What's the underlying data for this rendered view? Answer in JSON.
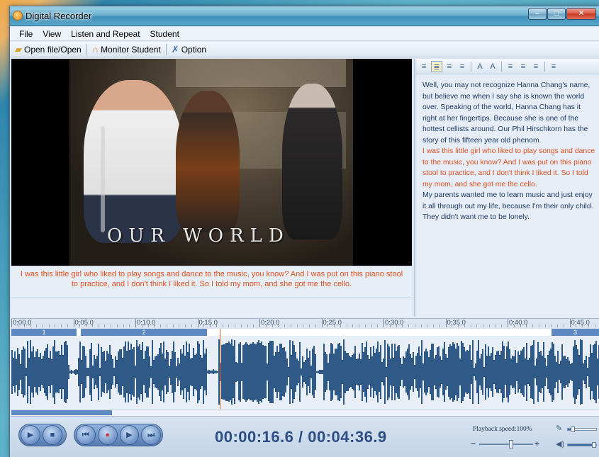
{
  "window": {
    "title": "Digital Recorder",
    "buttons": {
      "minimize": "–",
      "maximize": "□",
      "close": "✕"
    }
  },
  "menu": {
    "items": [
      "File",
      "View",
      "Listen and Repeat",
      "Student"
    ]
  },
  "toolbar": {
    "open_label": "Open file/Open",
    "monitor_label": "Monitor Student",
    "option_label": "Option"
  },
  "video": {
    "overlay_text": "OUR WORLD"
  },
  "subtitle": {
    "text": "I was this little girl who liked to play songs and dance to the music, you know? And I was put on this piano stool to practice, and I don't think I liked it. So I told my mom, and she got me the cello."
  },
  "transcript": {
    "para1": "Well, you may not recognize Hanna Chang's name, but believe me when I say she is known the world over. Speaking of the world, Hanna Chang has it right at her fingertips. Because she is one of the hottest cellists around. Our Phil Hirschkorn has the story of this fifteen year old phenom.",
    "para2_highlighted": "I was this little girl who liked to play songs and dance to the music, you know? And I was put on this piano stool to practice, and I don't think I liked it. So I told my mom, and she got me the cello.",
    "para3": "My parents wanted me to learn music and just enjoy it all through out my life, because I'm their only child. They didn't want me to be lonely."
  },
  "timeline": {
    "tick_labels": [
      "0:00.0",
      "0:05.0",
      "0:10.0",
      "0:15.0",
      "0:20.0",
      "0:25.0",
      "0:30.0",
      "0:35.0",
      "0:40.0",
      "0:45.0"
    ],
    "segments": [
      "1",
      "2",
      "3"
    ]
  },
  "playback": {
    "time_display": "00:00:16.6 / 00:04:36.9",
    "speed_label": "Playback speed:100%",
    "speed_fraction": 0.6,
    "mic_level": 0.1,
    "volume_level": 0.95
  },
  "colors": {
    "highlight": "#e2501e",
    "transcript_text": "#1e3a66",
    "waveform": "#2f5a88",
    "playhead": "#e0652a"
  }
}
